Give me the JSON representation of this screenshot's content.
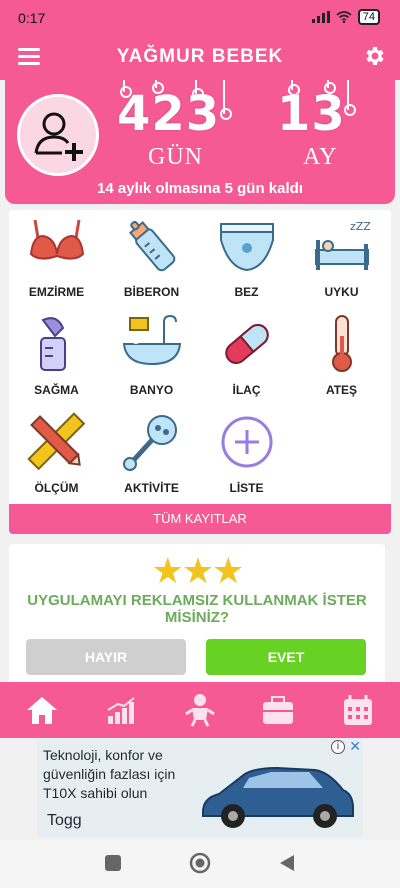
{
  "status": {
    "time": "0:17",
    "battery": "74"
  },
  "appbar": {
    "title": "YAĞMUR BEBEK"
  },
  "hero": {
    "days": "423",
    "days_unit": "GÜN",
    "months": "13",
    "months_unit": "AY",
    "countdown": "14 aylık olmasına 5 gün kaldı"
  },
  "tiles": [
    {
      "label": "EMZİRME",
      "icon": "bra-icon"
    },
    {
      "label": "BİBERON",
      "icon": "baby-bottle-icon"
    },
    {
      "label": "BEZ",
      "icon": "diaper-icon"
    },
    {
      "label": "UYKU",
      "icon": "sleep-bed-icon"
    },
    {
      "label": "SAĞMA",
      "icon": "breast-pump-icon"
    },
    {
      "label": "BANYO",
      "icon": "bathtub-icon"
    },
    {
      "label": "İLAÇ",
      "icon": "pill-icon"
    },
    {
      "label": "ATEŞ",
      "icon": "thermometer-icon"
    },
    {
      "label": "ÖLÇÜM",
      "icon": "ruler-pencil-icon"
    },
    {
      "label": "AKTİVİTE",
      "icon": "rattle-icon"
    },
    {
      "label": "LİSTE",
      "icon": "plus-circle-icon"
    }
  ],
  "all_records": "TÜM KAYITLAR",
  "promo": {
    "question": "UYGULAMAYI REKLAMSIZ KULLANMAK İSTER MİSİNİZ?",
    "no": "HAYIR",
    "yes": "EVET",
    "stars": "★★★"
  },
  "ad": {
    "text": "Teknoloji, konfor ve güvenliğin fazlası için T10X sahibi olun",
    "brand": "Togg",
    "info": "i",
    "close": "✕"
  },
  "colors": {
    "primary": "#f65a95",
    "yes": "#67d124",
    "no": "#cfcfcf",
    "promo_text": "#6bab5b"
  }
}
